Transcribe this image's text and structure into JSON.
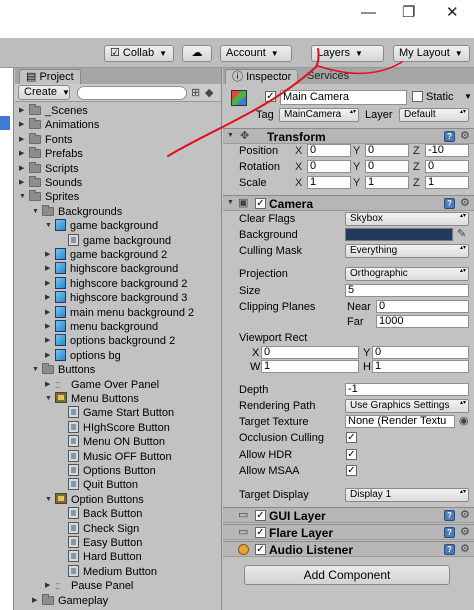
{
  "window": {
    "minimize": "—",
    "maximize": "❐",
    "close": "✕"
  },
  "toolbar": {
    "collab": "Collab",
    "cloud_icon": "cloud-icon",
    "account": "Account",
    "layers": "Layers",
    "layout": "My Layout"
  },
  "project": {
    "tab": "Project",
    "create": "Create",
    "items": [
      {
        "label": "_Scenes",
        "type": "folder",
        "depth": 0,
        "expand": "closed"
      },
      {
        "label": "Animations",
        "type": "folder",
        "depth": 0,
        "expand": "closed"
      },
      {
        "label": "Fonts",
        "type": "folder",
        "depth": 0,
        "expand": "closed"
      },
      {
        "label": "Prefabs",
        "type": "folder",
        "depth": 0,
        "expand": "closed"
      },
      {
        "label": "Scripts",
        "type": "folder",
        "depth": 0,
        "expand": "closed"
      },
      {
        "label": "Sounds",
        "type": "folder",
        "depth": 0,
        "expand": "closed"
      },
      {
        "label": "Sprites",
        "type": "folder",
        "depth": 0,
        "expand": "open"
      },
      {
        "label": "Backgrounds",
        "type": "folder",
        "depth": 1,
        "expand": "open"
      },
      {
        "label": "game background",
        "type": "sprite",
        "depth": 2,
        "expand": "open"
      },
      {
        "label": "game background",
        "type": "subsprite",
        "depth": 3,
        "expand": "none"
      },
      {
        "label": "game background 2",
        "type": "sprite",
        "depth": 2,
        "expand": "closed"
      },
      {
        "label": "highscore background",
        "type": "sprite",
        "depth": 2,
        "expand": "closed"
      },
      {
        "label": "highscore background 2",
        "type": "sprite",
        "depth": 2,
        "expand": "closed"
      },
      {
        "label": "highscore background 3",
        "type": "sprite",
        "depth": 2,
        "expand": "closed"
      },
      {
        "label": "main menu background 2",
        "type": "sprite",
        "depth": 2,
        "expand": "closed"
      },
      {
        "label": "menu background",
        "type": "sprite",
        "depth": 2,
        "expand": "closed"
      },
      {
        "label": "options background 2",
        "type": "sprite",
        "depth": 2,
        "expand": "closed"
      },
      {
        "label": "options bg",
        "type": "sprite",
        "depth": 2,
        "expand": "closed"
      },
      {
        "label": "Buttons",
        "type": "folder",
        "depth": 1,
        "expand": "open"
      },
      {
        "label": "Game Over Panel",
        "type": "dots",
        "depth": 2,
        "expand": "closed"
      },
      {
        "label": "Menu Buttons",
        "type": "btn",
        "depth": 2,
        "expand": "open"
      },
      {
        "label": "Game Start Button",
        "type": "subsprite",
        "depth": 3,
        "expand": "none"
      },
      {
        "label": "HIghScore Button",
        "type": "subsprite",
        "depth": 3,
        "expand": "none"
      },
      {
        "label": "Menu ON Button",
        "type": "subsprite",
        "depth": 3,
        "expand": "none"
      },
      {
        "label": "Music OFF Button",
        "type": "subsprite",
        "depth": 3,
        "expand": "none"
      },
      {
        "label": "Options Button",
        "type": "subsprite",
        "depth": 3,
        "expand": "none"
      },
      {
        "label": "Quit Button",
        "type": "subsprite",
        "depth": 3,
        "expand": "none"
      },
      {
        "label": "Option Buttons",
        "type": "btn",
        "depth": 2,
        "expand": "open"
      },
      {
        "label": "Back Button",
        "type": "subsprite",
        "depth": 3,
        "expand": "none"
      },
      {
        "label": "Check Sign",
        "type": "subsprite",
        "depth": 3,
        "expand": "none"
      },
      {
        "label": "Easy Button",
        "type": "subsprite",
        "depth": 3,
        "expand": "none"
      },
      {
        "label": "Hard Button",
        "type": "subsprite",
        "depth": 3,
        "expand": "none"
      },
      {
        "label": "Medium Button",
        "type": "subsprite",
        "depth": 3,
        "expand": "none"
      },
      {
        "label": "Pause Panel",
        "type": "dots",
        "depth": 2,
        "expand": "closed"
      },
      {
        "label": "Gameplay",
        "type": "folder",
        "depth": 1,
        "expand": "closed"
      }
    ]
  },
  "inspector": {
    "tab": "Inspector",
    "tab2": "Services",
    "object_name": "Main Camera",
    "static_label": "Static",
    "tag_label": "Tag",
    "tag_value": "MainCamera",
    "layer_label": "Layer",
    "layer_value": "Default",
    "transform": {
      "title": "Transform",
      "rows": [
        {
          "label": "Position",
          "x": "0",
          "y": "0",
          "z": "-10"
        },
        {
          "label": "Rotation",
          "x": "0",
          "y": "0",
          "z": "0"
        },
        {
          "label": "Scale",
          "x": "1",
          "y": "1",
          "z": "1"
        }
      ]
    },
    "camera": {
      "title": "Camera",
      "clear_flags_label": "Clear Flags",
      "clear_flags": "Skybox",
      "background_label": "Background",
      "background_color": "#233a5e",
      "culling_label": "Culling Mask",
      "culling": "Everything",
      "projection_label": "Projection",
      "projection": "Orthographic",
      "size_label": "Size",
      "size": "5",
      "clipping_label": "Clipping Planes",
      "near_label": "Near",
      "near": "0",
      "far_label": "Far",
      "far": "1000",
      "viewport_label": "Viewport Rect",
      "vx_label": "X",
      "vx": "0",
      "vy_label": "Y",
      "vy": "0",
      "vw_label": "W",
      "vw": "1",
      "vh_label": "H",
      "vh": "1",
      "depth_label": "Depth",
      "depth": "-1",
      "rendering_label": "Rendering Path",
      "rendering": "Use Graphics Settings",
      "target_tex_label": "Target Texture",
      "target_tex": "None (Render Textu",
      "occlusion_label": "Occlusion Culling",
      "hdr_label": "Allow HDR",
      "msaa_label": "Allow MSAA",
      "display_label": "Target Display",
      "display": "Display 1"
    },
    "gui_layer": "GUI Layer",
    "flare_layer": "Flare Layer",
    "audio_listener": "Audio Listener",
    "add_component": "Add Component"
  },
  "colors": {
    "annotation": "#e0101a",
    "selection": "#3d7bd6"
  }
}
